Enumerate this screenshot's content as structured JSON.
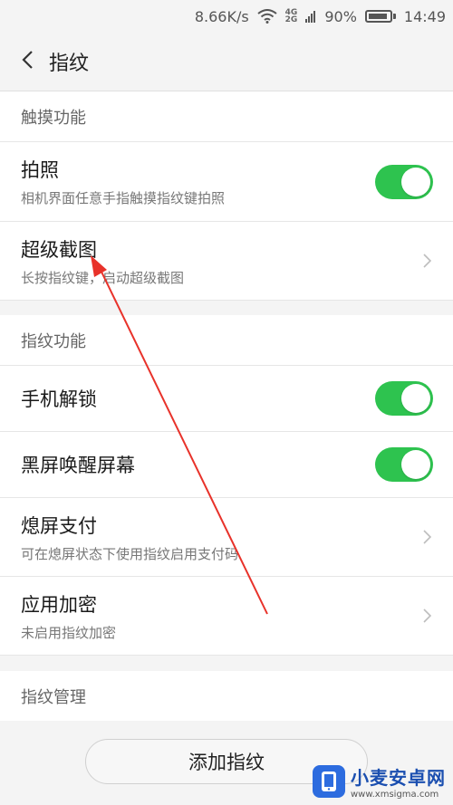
{
  "status_bar": {
    "speed": "8.66K/s",
    "net_top": "4G",
    "net_bottom": "2G",
    "battery_percent": "90%",
    "battery_level": 0.9,
    "time": "14:49"
  },
  "header": {
    "title": "指纹"
  },
  "section_touch": {
    "heading": "触摸功能",
    "items": [
      {
        "title": "拍照",
        "subtitle": "相机界面任意手指触摸指纹键拍照",
        "control": "toggle",
        "on": true
      },
      {
        "title": "超级截图",
        "subtitle": "长按指纹键，启动超级截图",
        "control": "chevron"
      }
    ]
  },
  "section_fingerprint": {
    "heading": "指纹功能",
    "items": [
      {
        "title": "手机解锁",
        "control": "toggle",
        "on": true
      },
      {
        "title": "黑屏唤醒屏幕",
        "control": "toggle",
        "on": true
      },
      {
        "title": "熄屏支付",
        "subtitle": "可在熄屏状态下使用指纹启用支付码",
        "control": "chevron"
      },
      {
        "title": "应用加密",
        "subtitle": "未启用指纹加密",
        "control": "chevron"
      }
    ]
  },
  "section_manage": {
    "heading": "指纹管理"
  },
  "add_button": {
    "label": "添加指纹"
  },
  "watermark": {
    "title": "小麦安卓网",
    "url": "www.xmsigma.com"
  },
  "colors": {
    "toggle_on": "#2ec34f",
    "arrow": "#e8322a"
  }
}
